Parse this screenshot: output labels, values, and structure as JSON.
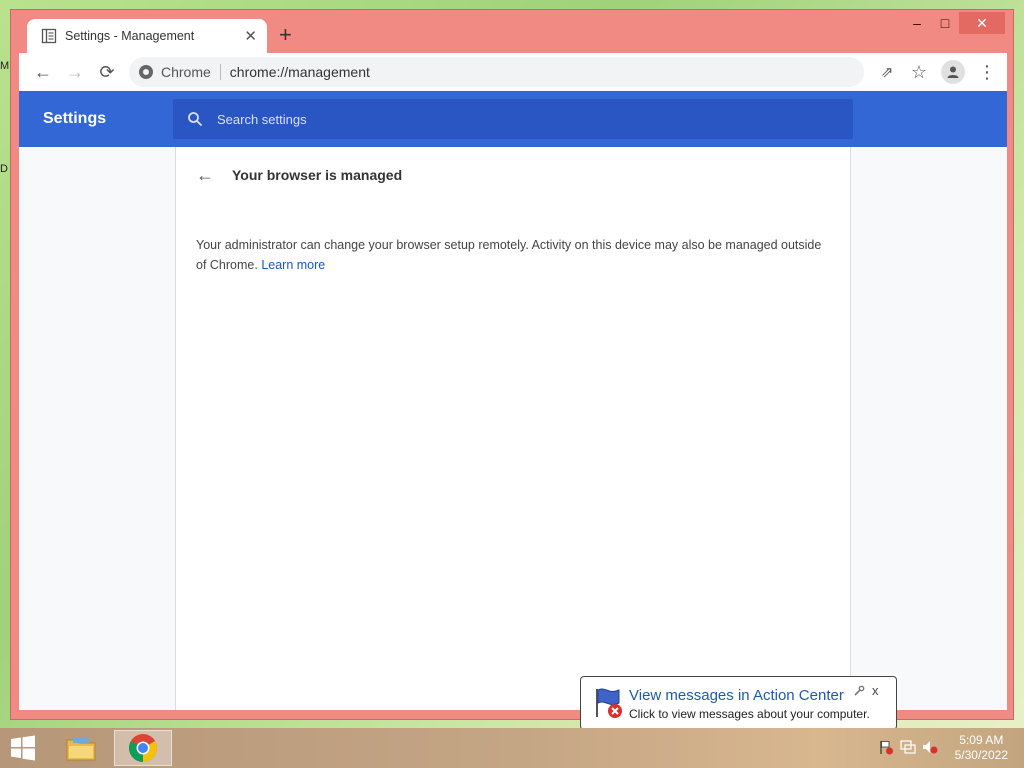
{
  "desktop": {
    "frag_top": "M",
    "frag_mid": "D"
  },
  "window": {
    "controls": {
      "minimize": "–",
      "maximize": "□",
      "close": "✕"
    },
    "tab": {
      "title": "Settings - Management",
      "close": "✕",
      "new_tab": "+"
    },
    "toolbar": {
      "back": "←",
      "forward": "→",
      "reload": "⟳",
      "site_label": "Chrome",
      "url": "chrome://management",
      "share": "⇗",
      "bookmark": "☆",
      "menu": "⋮"
    }
  },
  "settings": {
    "title": "Settings",
    "search_placeholder": "Search settings",
    "page": {
      "back": "←",
      "title": "Your browser is managed",
      "description": "Your administrator can change your browser setup remotely. Activity on this device may also be managed outside of Chrome.",
      "learn_more": "Learn more"
    }
  },
  "notification": {
    "title": "View messages in Action Center",
    "text": "Click to view messages about your computer.",
    "close": "x"
  },
  "taskbar": {
    "time": "5:09 AM",
    "date": "5/30/2022"
  },
  "colors": {
    "window_frame": "#f28a84",
    "settings_blue": "#3367d6",
    "search_blue": "#2a56c4",
    "link": "#1a56c8"
  }
}
